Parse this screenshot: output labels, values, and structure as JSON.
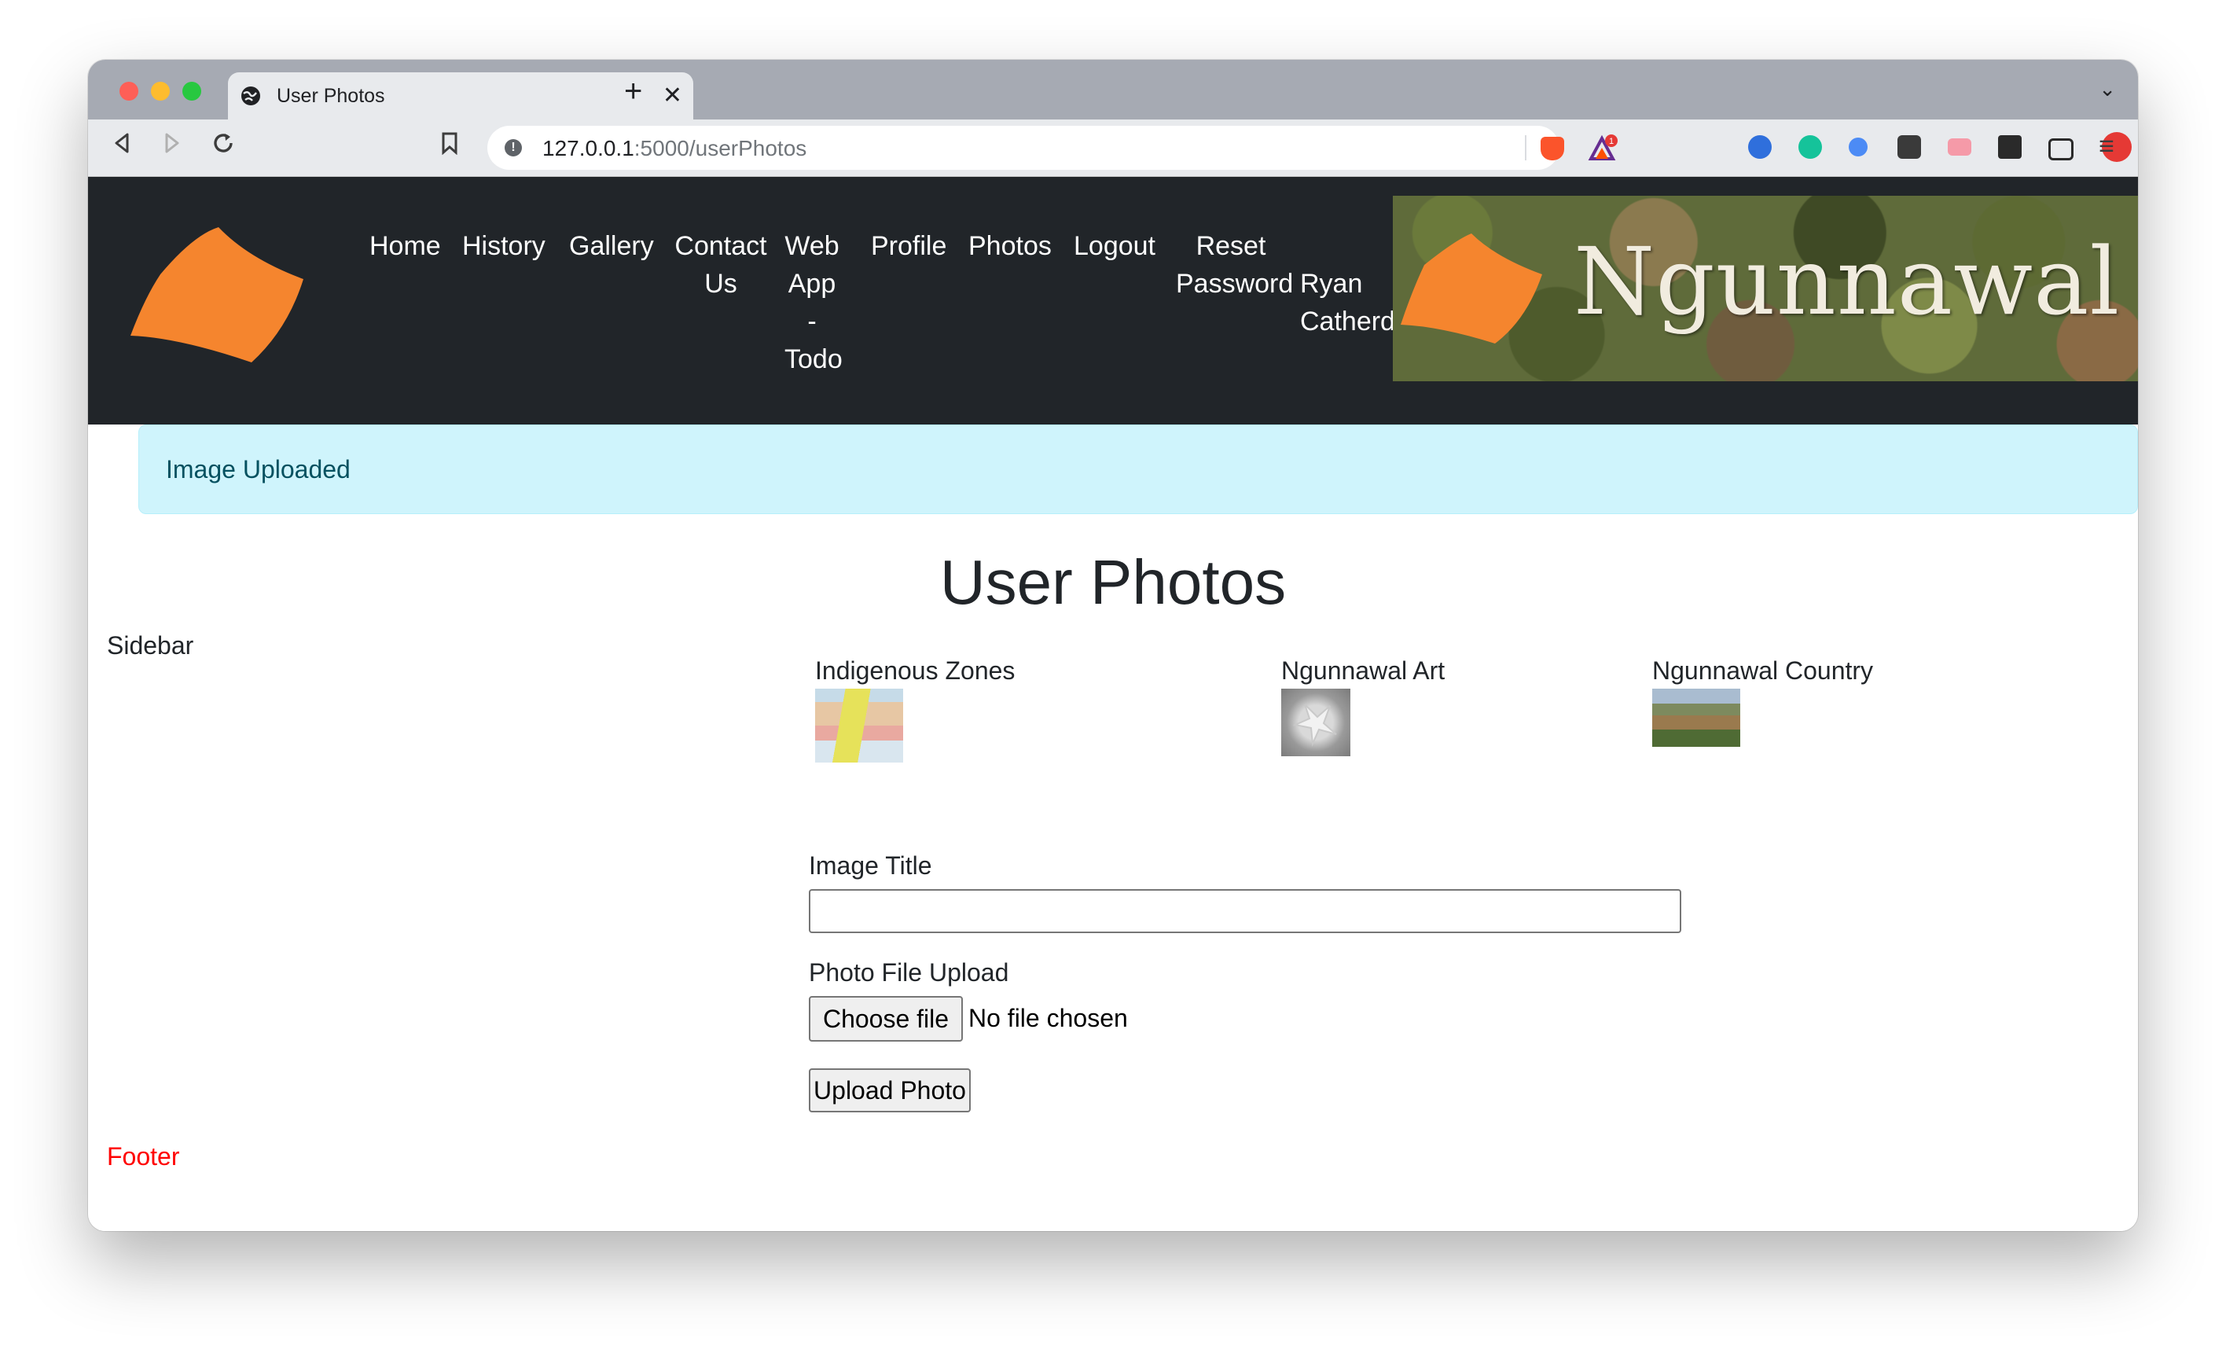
{
  "browser": {
    "tab_title": "User Photos",
    "url_host": "127.0.0.1",
    "url_path": ":5000/userPhotos",
    "badge_count": "1"
  },
  "nav": {
    "home": "Home",
    "history": "History",
    "gallery": "Gallery",
    "contact_line1": "Contact",
    "contact_line2": "Us",
    "webapp_line1": "Web",
    "webapp_line2": "App",
    "webapp_line3": "-",
    "webapp_line4": "Todo",
    "profile": "Profile",
    "photos": "Photos",
    "logout": "Logout",
    "reset_line1": "Reset",
    "reset_line2": "Password",
    "user_line1": "Ryan",
    "user_line2": "Catherd"
  },
  "banner": {
    "text": "Ngunnawal"
  },
  "alert": {
    "message": "Image Uploaded"
  },
  "page": {
    "title": "User Photos"
  },
  "sidebar": {
    "label": "Sidebar"
  },
  "photos": [
    {
      "title": "Indigenous Zones"
    },
    {
      "title": "Ngunnawal Art"
    },
    {
      "title": "Ngunnawal Country"
    }
  ],
  "form": {
    "image_title_label": "Image Title",
    "image_title_value": "",
    "file_upload_label": "Photo File Upload",
    "choose_file_label": "Choose file",
    "no_file_text": "No file chosen",
    "upload_button_label": "Upload Photo"
  },
  "footer": {
    "label": "Footer"
  },
  "colors": {
    "header_bg": "#212529",
    "alert_bg": "#cff4fc",
    "alert_text": "#055160",
    "logo_orange": "#f5852e",
    "footer_text": "#ff0000"
  }
}
